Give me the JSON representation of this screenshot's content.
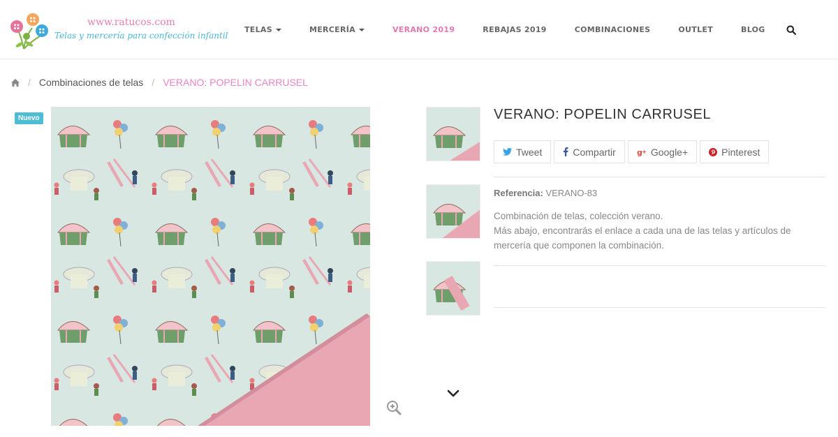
{
  "logo": {
    "url_text": "www.ratucos.com",
    "tagline": "Telas y mercería para confección infantil"
  },
  "nav": {
    "items": [
      {
        "label": "TELAS",
        "dropdown": true,
        "active": false
      },
      {
        "label": "MERCERÍA",
        "dropdown": true,
        "active": false
      },
      {
        "label": "VERANO 2019",
        "dropdown": false,
        "active": true
      },
      {
        "label": "REBAJAS 2019",
        "dropdown": false,
        "active": false
      },
      {
        "label": "COMBINACIONES",
        "dropdown": false,
        "active": false
      },
      {
        "label": "OUTLET",
        "dropdown": false,
        "active": false
      },
      {
        "label": "BLOG",
        "dropdown": false,
        "active": false
      }
    ],
    "search_icon": "search-icon"
  },
  "breadcrumb": {
    "home_icon": "home-icon",
    "separator": "/",
    "parent": "Combinaciones de telas",
    "current": "VERANO: POPELIN CARRUSEL"
  },
  "product": {
    "badge": "Nuevo",
    "title": "VERANO: POPELIN CARRUSEL",
    "share": {
      "tweet": "Tweet",
      "facebook": "Compartir",
      "google": "Google+",
      "pinterest": "Pinterest"
    },
    "ref_label": "Referencia:",
    "ref_value": "VERANO-83",
    "desc_line1": "Combinación de telas, colección verano.",
    "desc_line2": "Más abajo, encontrarás el enlace a cada una de las telas y artículos de mercería que componen la combinación."
  },
  "colors": {
    "accent_pink": "#e07ab0",
    "accent_blue": "#4fbcd6",
    "fabric_pink": "#e9a7b4"
  }
}
